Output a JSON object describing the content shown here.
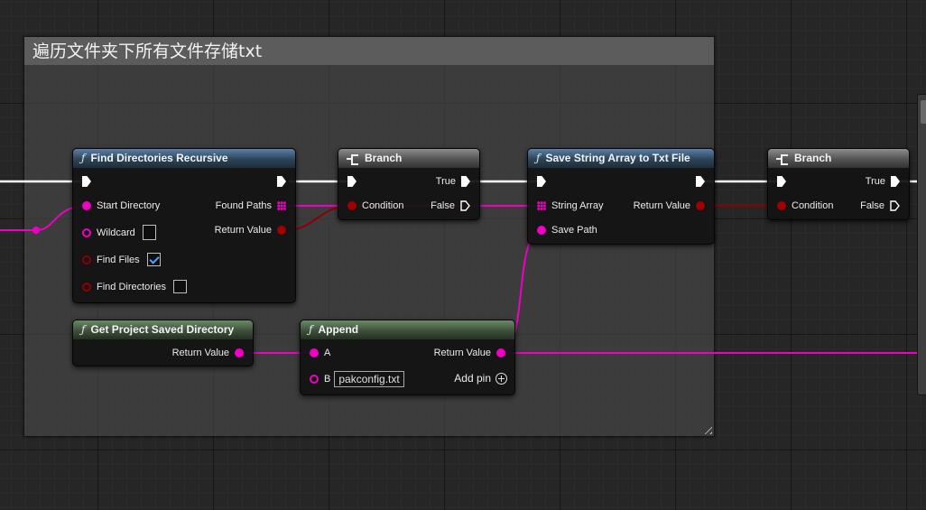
{
  "comment": {
    "title": "遍历文件夹下所有文件存储txt"
  },
  "colors": {
    "exec_wire": "#ffffff",
    "string_wire": "#f000c4",
    "bool_wire": "#8e0000",
    "function_header": "#3b5f86",
    "pure_header": "#4e6d4a",
    "branch_header": "#6e6e6e"
  },
  "nodes": {
    "find_dirs": {
      "title": "Find Directories Recursive",
      "icon": "function-icon",
      "pins": {
        "start_directory": "Start Directory",
        "wildcard": "Wildcard",
        "find_files": "Find Files",
        "find_directories": "Find Directories",
        "found_paths": "Found Paths",
        "return_value": "Return Value"
      },
      "find_files_checked": true,
      "find_directories_checked": false
    },
    "branch1": {
      "title": "Branch",
      "icon": "branch-icon",
      "pins": {
        "condition": "Condition",
        "true": "True",
        "false": "False"
      }
    },
    "save_txt": {
      "title": "Save String Array to Txt File",
      "icon": "function-icon",
      "pins": {
        "string_array": "String Array",
        "save_path": "Save Path",
        "return_value": "Return Value"
      }
    },
    "branch2": {
      "title": "Branch",
      "icon": "branch-icon",
      "pins": {
        "condition": "Condition",
        "true": "True",
        "false": "False"
      }
    },
    "get_saved_dir": {
      "title": "Get Project Saved Directory",
      "icon": "function-icon",
      "pins": {
        "return_value": "Return Value"
      }
    },
    "append": {
      "title": "Append",
      "icon": "function-icon",
      "pins": {
        "a": "A",
        "b": "B",
        "return_value": "Return Value"
      },
      "b_value": "pakconfig.txt",
      "add_pin_label": "Add pin"
    }
  }
}
